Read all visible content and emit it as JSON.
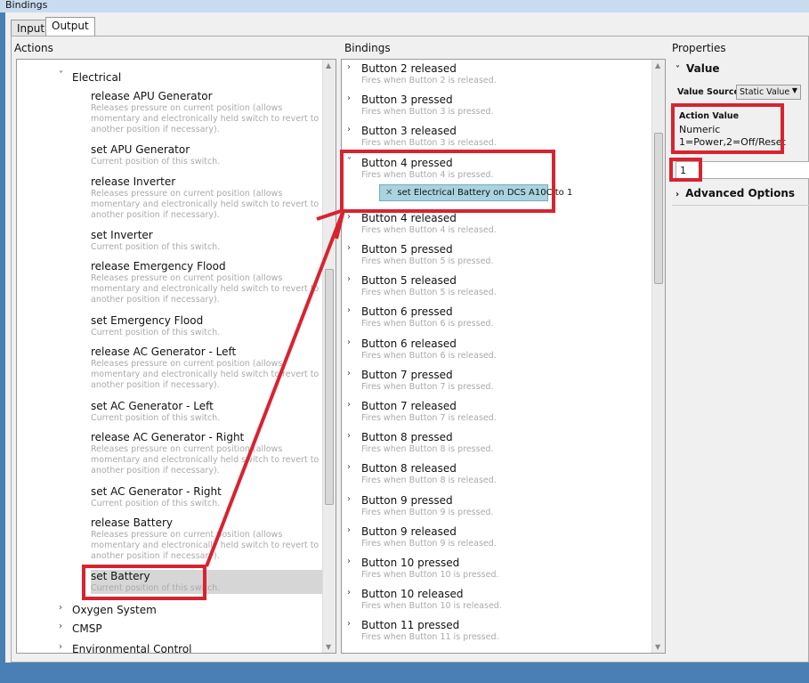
{
  "window": {
    "title": "Bindings"
  },
  "tabs": [
    "Input",
    "Output"
  ],
  "actions": {
    "label": "Actions",
    "groups_top": "Electrical",
    "items": [
      {
        "title": "release APU Generator",
        "desc": "Releases pressure on current position (allows momentary and electronically held switch to revert to another position if necessary)."
      },
      {
        "title": "set APU Generator",
        "desc": "Current position of this switch."
      },
      {
        "title": "release Inverter",
        "desc": "Releases pressure on current position (allows momentary and electronically held switch to revert to another position if necessary)."
      },
      {
        "title": "set Inverter",
        "desc": "Current position of this switch."
      },
      {
        "title": "release Emergency Flood",
        "desc": "Releases pressure on current position (allows momentary and electronically held switch to revert to another position if necessary)."
      },
      {
        "title": "set Emergency Flood",
        "desc": "Current position of this switch."
      },
      {
        "title": "release AC Generator - Left",
        "desc": "Releases pressure on current position (allows momentary and electronically held switch to revert to another position if necessary)."
      },
      {
        "title": "set AC Generator - Left",
        "desc": "Current position of this switch."
      },
      {
        "title": "release AC Generator - Right",
        "desc": "Releases pressure on current position (allows momentary and electronically held switch to revert to another position if necessary)."
      },
      {
        "title": "set AC Generator - Right",
        "desc": "Current position of this switch."
      },
      {
        "title": "release Battery",
        "desc": "Releases pressure on current position (allows momentary and electronically held switch to revert to another position if necessary)."
      },
      {
        "title": "set Battery",
        "desc": "Current position of this switch."
      }
    ],
    "groups_bottom": [
      "Oxygen System",
      "CMSP",
      "Environmental Control"
    ]
  },
  "bindings": {
    "label": "Bindings",
    "items": [
      {
        "title": "Button 2 released",
        "desc": "Fires when Button 2 is released."
      },
      {
        "title": "Button 3 pressed",
        "desc": "Fires when Button 3 is pressed."
      },
      {
        "title": "Button 3 released",
        "desc": "Fires when Button 3 is released."
      },
      {
        "title": "Button 4 pressed",
        "desc": "Fires when Button 4 is pressed."
      },
      {
        "title": "Button 4 released",
        "desc": "Fires when Button 4 is released."
      },
      {
        "title": "Button 5 pressed",
        "desc": "Fires when Button 5 is pressed."
      },
      {
        "title": "Button 5 released",
        "desc": "Fires when Button 5 is released."
      },
      {
        "title": "Button 6 pressed",
        "desc": "Fires when Button 6 is pressed."
      },
      {
        "title": "Button 6 released",
        "desc": "Fires when Button 6 is released."
      },
      {
        "title": "Button 7 pressed",
        "desc": "Fires when Button 7 is pressed."
      },
      {
        "title": "Button 7 released",
        "desc": "Fires when Button 7 is released."
      },
      {
        "title": "Button 8 pressed",
        "desc": "Fires when Button 8 is pressed."
      },
      {
        "title": "Button 8 released",
        "desc": "Fires when Button 8 is released."
      },
      {
        "title": "Button 9 pressed",
        "desc": "Fires when Button 9 is pressed."
      },
      {
        "title": "Button 9 released",
        "desc": "Fires when Button 9 is released."
      },
      {
        "title": "Button 10 pressed",
        "desc": "Fires when Button 10 is pressed."
      },
      {
        "title": "Button 10 released",
        "desc": "Fires when Button 10 is released."
      },
      {
        "title": "Button 11 pressed",
        "desc": "Fires when Button 11 is pressed."
      }
    ],
    "chip": "set Electrical Battery on DCS A10C to  1"
  },
  "properties": {
    "label": "Properties",
    "section": "Value",
    "value_source_label": "Value Source",
    "value_source": "Static Value",
    "action_value_label": "Action Value",
    "action_value_type": "Numeric",
    "action_value_hint": "1=Power,2=Off/Reset",
    "value": "1",
    "advanced": "Advanced Options"
  },
  "colors": {
    "highlight": "#d82330",
    "chip": "#a9d3e0"
  }
}
